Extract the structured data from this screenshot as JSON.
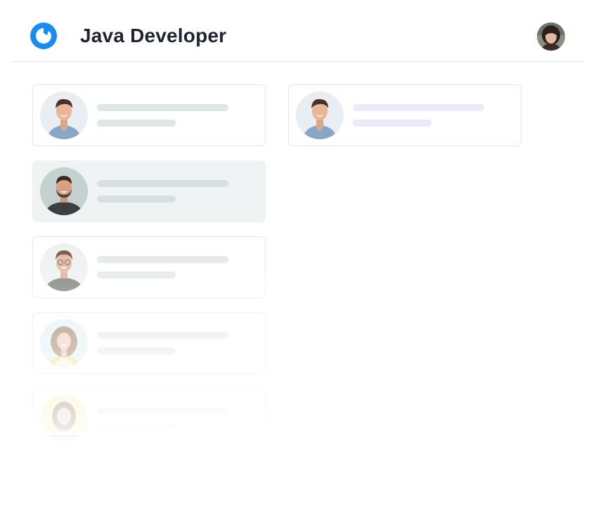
{
  "header": {
    "title": "Java Developer",
    "logo_icon": "brand-logo-icon",
    "avatar_icon": "user-avatar"
  },
  "colors": {
    "brand": "#1a8cf0",
    "skeleton": "#e1e7e5",
    "skeleton_accent": "#ebe9fb",
    "selected_bg": "#f0f3f4"
  },
  "candidates_column_1": [
    {
      "avatar": "man-smiling-denim-shirt-avatar",
      "state": "default"
    },
    {
      "avatar": "man-bearded-dark-shirt-avatar",
      "state": "selected"
    },
    {
      "avatar": "man-glasses-grey-tee-avatar",
      "state": "default"
    },
    {
      "avatar": "woman-curly-hair-avatar",
      "state": "default"
    },
    {
      "avatar": "woman-striped-top-avatar",
      "state": "default"
    }
  ],
  "candidates_column_2": [
    {
      "avatar": "man-smiling-denim-shirt-avatar",
      "state": "accent"
    }
  ]
}
